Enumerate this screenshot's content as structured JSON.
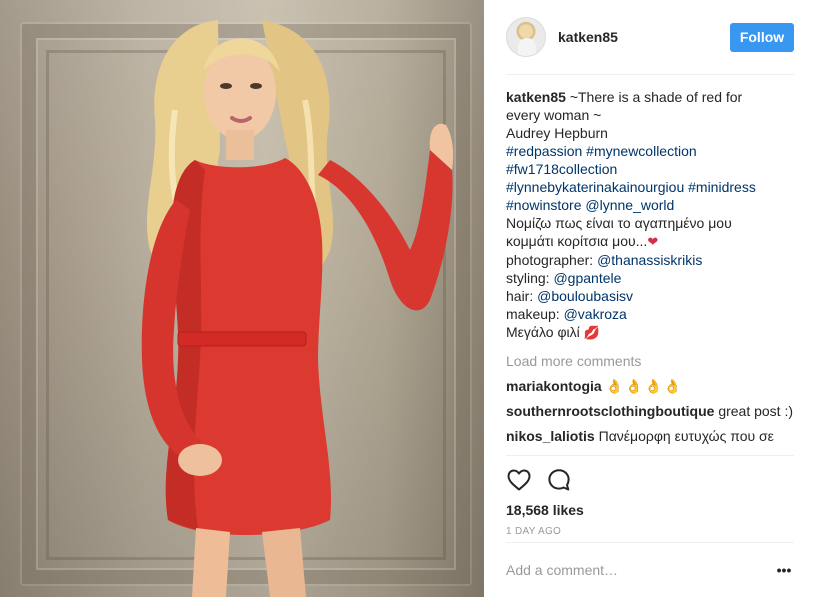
{
  "post": {
    "header": {
      "username": "katken85",
      "follow_label": "Follow"
    },
    "caption": {
      "username": "katken85",
      "lines": [
        "~There is a shade of red for",
        "every woman ~",
        "Audrey Hepburn"
      ],
      "hashtags": [
        "#redpassion",
        "#mynewcollection",
        "#fw1718collection",
        "#lynnebykaterinakainourgiou",
        "#minidress",
        "#nowinstore"
      ],
      "mention_lynne": "@lynne_world",
      "greek_line": "Νομίζω πως είναι το αγαπημένο μου",
      "greek_line2": "κομμάτι κορίτσια μου...",
      "photographer_label": "photographer:",
      "photographer": "@thanassiskrikis",
      "styling_label": "styling:",
      "styling": "@gpantele",
      "hair_label": "hair:",
      "hair": "@bouloubasisv",
      "makeup_label": "makeup:",
      "makeup": "@vakroza",
      "closing": "Μεγάλο φιλί",
      "heart_emoji": "❤",
      "lips_emoji": "💋"
    },
    "load_more": "Load more comments",
    "comments": [
      {
        "user": "mariakontogia",
        "text": "👌👌👌👌"
      },
      {
        "user": "southernrootsclothingboutique",
        "text": "great post :)"
      },
      {
        "user": "nikos_laliotis",
        "text": "Πανέμορφη ευτυχώς που σε"
      }
    ],
    "likes": "18,568 likes",
    "time_ago": "1 DAY AGO",
    "add_comment_placeholder": "Add a comment…",
    "more_label": "•••",
    "icons": {
      "like": "heart-outline-icon",
      "comment": "speech-bubble-icon",
      "more": "more-dots-icon"
    },
    "colors": {
      "follow_button": "#3897f0",
      "link": "#003569",
      "muted": "#999999",
      "text": "#262626"
    }
  }
}
